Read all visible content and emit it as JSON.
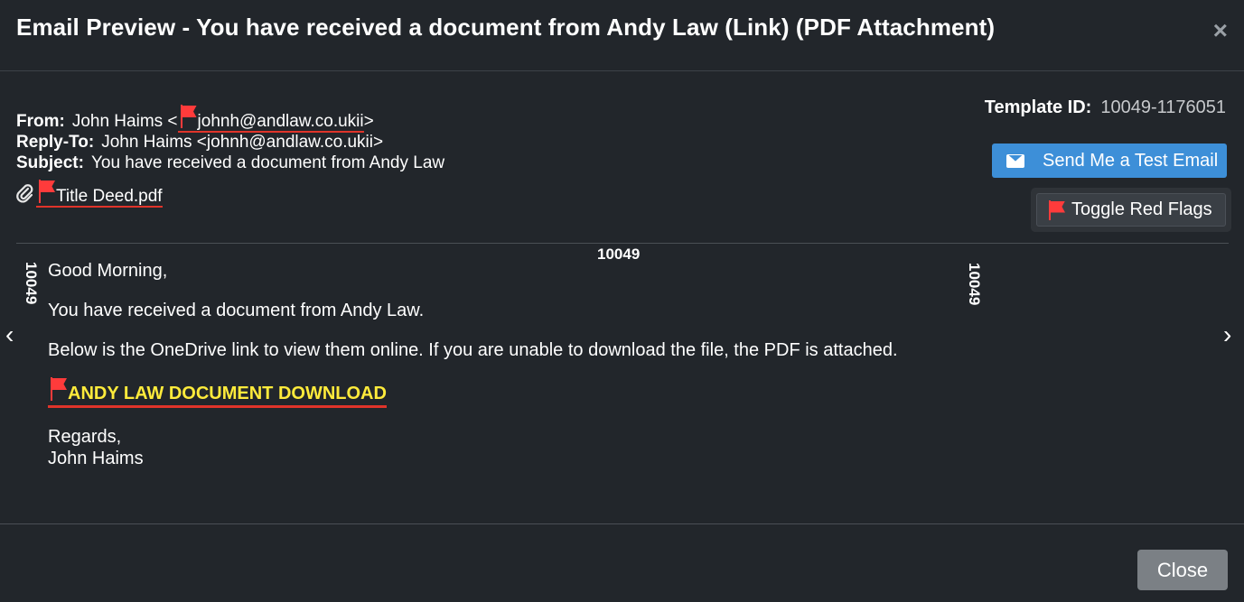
{
  "header": {
    "title": "Email Preview -  You have received a document from Andy Law (Link) (PDF Attachment)",
    "close_glyph": "×"
  },
  "email": {
    "from_label": "From:",
    "from_name": "John Haims",
    "from_addr": "johnh@andlaw.co.ukii",
    "reply_label": "Reply-To:",
    "reply_name": "John Haims",
    "reply_addr": "johnh@andlaw.co.ukii",
    "subject_label": "Subject:",
    "subject_text": "You have received a document from Andy Law",
    "attachment_name": "Title Deed.pdf"
  },
  "template": {
    "label": "Template ID:",
    "value": "10049-1176051"
  },
  "buttons": {
    "send_test": "Send Me a Test Email",
    "toggle_flags": "Toggle Red Flags",
    "close": "Close"
  },
  "body": {
    "template_code": "10049",
    "greeting": "Good Morning,",
    "line1": "You have received a document from Andy Law.",
    "line2": "Below is the OneDrive link to view them online. If you are unable to download the file, the PDF is attached.",
    "link_text": "ANDY LAW DOCUMENT DOWNLOAD",
    "closing": "Regards,",
    "signature": "John Haims"
  },
  "nav": {
    "prev": "‹",
    "next": "›"
  },
  "colors": {
    "background": "#22262b",
    "accent_blue": "#3d8fd8",
    "red_flag": "#ff3b3b",
    "link_yellow": "#ffeb3b"
  },
  "icons": [
    "close-icon",
    "red-flag-icon",
    "paperclip-icon",
    "envelope-icon",
    "chevron-left-icon",
    "chevron-right-icon"
  ]
}
